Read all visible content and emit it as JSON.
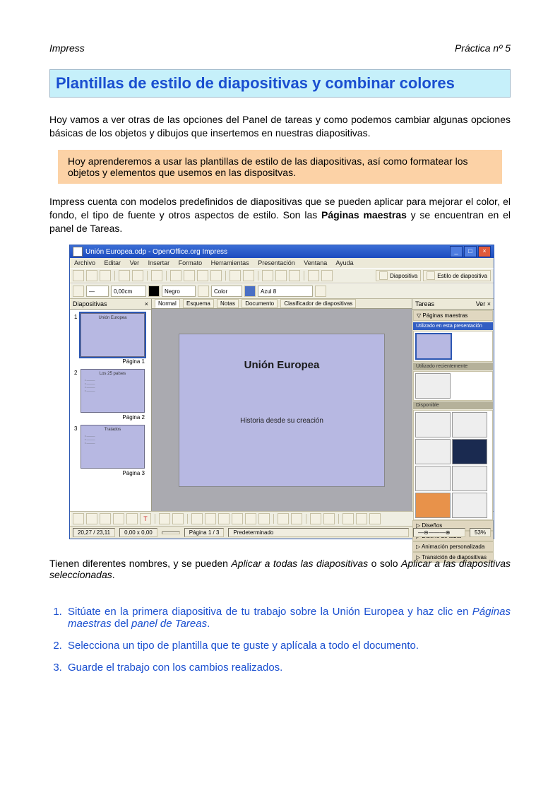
{
  "header": {
    "left": "Impress",
    "right": "Práctica nº 5"
  },
  "title": "Plantillas de estilo de diapositivas y combinar colores",
  "intro": "Hoy vamos a ver otras de las opciones del Panel de tareas y como podemos cambiar algunas opciones básicas de los objetos y dibujos que insertemos en nuestras diapositivas.",
  "callout": "Hoy aprenderemos a usar las plantillas de estilo de las diapositivas, así como formatear los objetos y elementos que usemos en las dispositvas.",
  "para2_pre": "Impress cuenta con modelos predefinidos de diapositivas que se pueden aplicar para mejorar el color, el fondo, el tipo de fuente y otros aspectos de estilo. Son las ",
  "para2_bold": "Páginas maestras",
  "para2_post": " y se encuentran en el panel de Tareas.",
  "screenshot": {
    "window_title": "Unión Europea.odp - OpenOffice.org Impress",
    "menus": [
      "Archivo",
      "Editar",
      "Ver",
      "Insertar",
      "Formato",
      "Herramientas",
      "Presentación",
      "Ventana",
      "Ayuda"
    ],
    "toolbar2": {
      "line_width": "0,00cm",
      "line_color": "Negro",
      "fill_label": "Color",
      "fill_color": "Azul 8"
    },
    "top_right_buttons": [
      "Diapositiva",
      "Estilo de diapositiva"
    ],
    "slides_panel": {
      "title": "Diapositivas",
      "items": [
        {
          "num": "1",
          "title": "Unión Europea",
          "caption": "Página 1"
        },
        {
          "num": "2",
          "title": "Los 25 países",
          "caption": "Página 2"
        },
        {
          "num": "3",
          "title": "Tratados",
          "caption": "Página 3"
        }
      ]
    },
    "center": {
      "tabs": [
        "Normal",
        "Esquema",
        "Notas",
        "Documento",
        "Clasificador de diapositivas"
      ],
      "slide_title": "Unión Europea",
      "slide_body": "Historia desde su creación"
    },
    "tasks_panel": {
      "title": "Tareas",
      "view_label": "Ver",
      "main_section": "Páginas maestras",
      "sub1": "Utilizado en esta presentación",
      "sub2": "Utilizado recientemente",
      "sub3": "Disponible",
      "accordion": [
        "Diseños",
        "Diseño de tabla",
        "Animación personalizada",
        "Transición de diapositivas"
      ]
    },
    "status": {
      "coords": "20,27 / 23,11",
      "size": "0,00 x 0,00",
      "page": "Página 1 / 3",
      "layout": "Predeterminado",
      "zoom": "53%"
    }
  },
  "after_para_pre": "Tienen diferentes nombres, y se pueden ",
  "after_para_i1": "Aplicar a todas las diapositivas",
  "after_para_mid": " o solo ",
  "after_para_i2": "Aplicar a las diapositivas seleccionadas",
  "after_para_post": ".",
  "steps": {
    "s1_pre": "Sitúate en la primera diapositiva de tu trabajo sobre la Unión Europea y haz clic en ",
    "s1_i1": "Páginas maestras",
    "s1_mid": " del ",
    "s1_i2": "panel de Tareas",
    "s1_post": ".",
    "s2": "Selecciona un tipo de plantilla que te guste y aplícala a todo el documento.",
    "s3": "Guarde el trabajo con los cambios realizados."
  }
}
